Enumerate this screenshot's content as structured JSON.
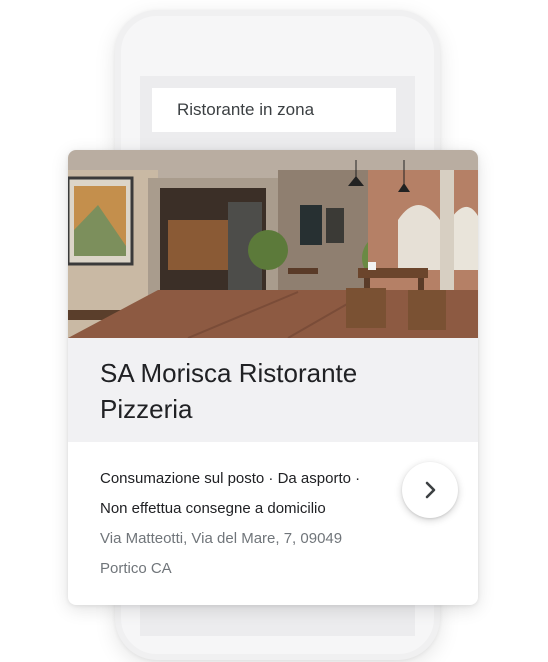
{
  "search": {
    "query": "Ristorante in zona"
  },
  "result_card": {
    "name": "SA Morisca Ristorante Pizzeria",
    "services_line1": "Consumazione sul posto · Da asporto ·",
    "services_line2": "Non effettua consegne a domicilio",
    "address_line1": "Via Matteotti, Via del Mare, 7, 09049",
    "address_line2": "Portico CA",
    "next_icon": "chevron-right-icon"
  },
  "colors": {
    "title_band": "#f1f1f3",
    "text_primary": "#202124",
    "text_secondary": "#70757a"
  }
}
